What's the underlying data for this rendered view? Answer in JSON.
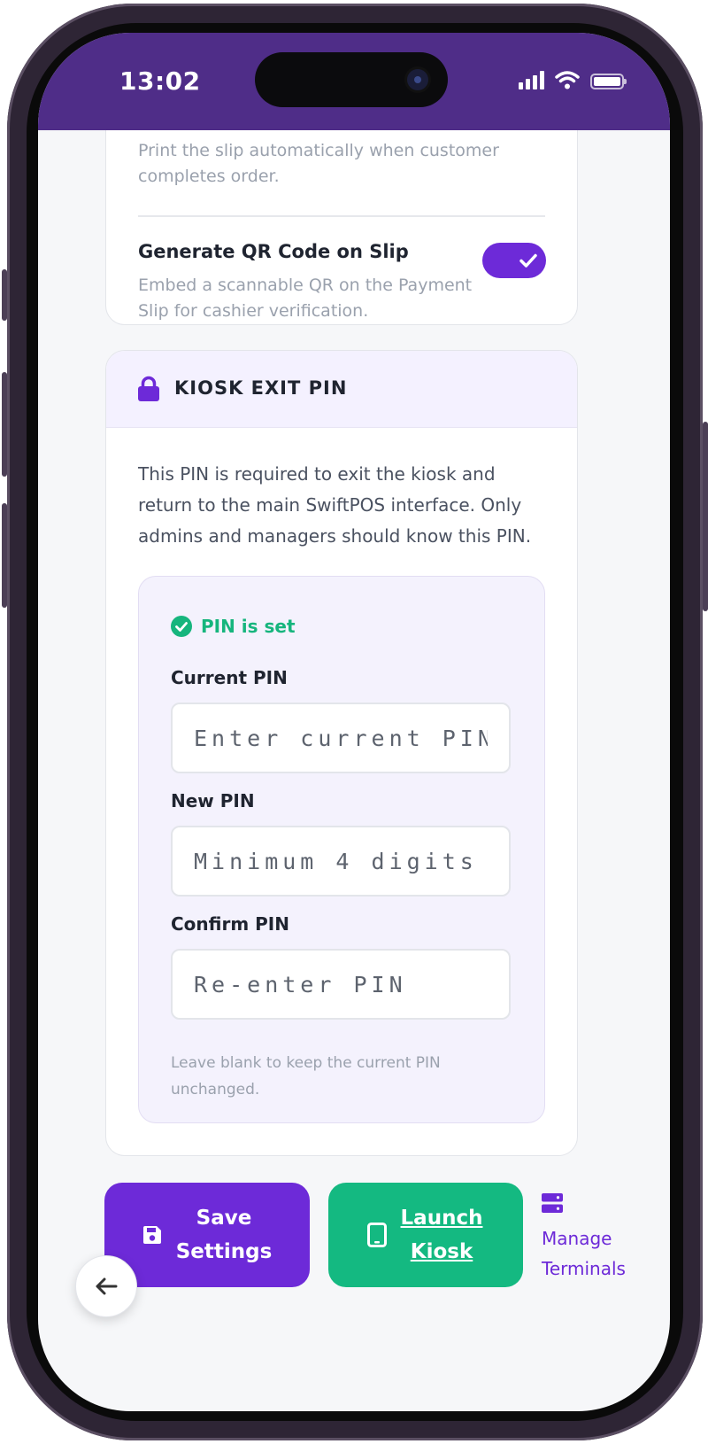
{
  "status_bar": {
    "time": "13:02"
  },
  "auto_print": {
    "description": "Print the slip automatically when customer completes order."
  },
  "qr_code": {
    "title": "Generate QR Code on Slip",
    "description": "Embed a scannable QR on the Payment Slip for cashier verification.",
    "enabled": true
  },
  "kiosk_pin": {
    "title": "KIOSK EXIT PIN",
    "info": "This PIN is required to exit the kiosk and return to the main SwiftPOS interface. Only admins and managers should know this PIN.",
    "status": "PIN is set",
    "current_label": "Current PIN",
    "current_placeholder": "Enter current PIN",
    "new_label": "New PIN",
    "new_placeholder": "Minimum 4 digits",
    "confirm_label": "Confirm PIN",
    "confirm_placeholder": "Re-enter PIN",
    "hint": "Leave blank to keep the current PIN unchanged."
  },
  "actions": {
    "save_label": "Save Settings",
    "launch_label": "Launch Kiosk",
    "manage_label": "Manage Terminals"
  },
  "colors": {
    "primary": "#6d2ad8",
    "success": "#14b981",
    "status_bar": "#4f2d88",
    "background": "#f6f7f9"
  },
  "icons": {
    "lock": "lock-icon",
    "check": "check-circle-icon",
    "save": "floppy-disk-icon",
    "tablet": "tablet-icon",
    "server": "server-icon",
    "back": "arrow-left-icon"
  }
}
